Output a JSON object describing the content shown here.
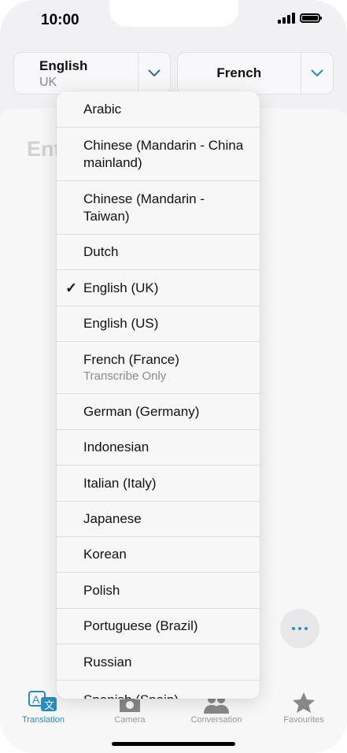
{
  "status_bar": {
    "time": "10:00"
  },
  "language_selector": {
    "source": {
      "name": "English",
      "region": "UK"
    },
    "target": {
      "name": "French"
    }
  },
  "input": {
    "placeholder_partial": "Ent"
  },
  "dropdown": {
    "items": [
      {
        "label": "Arabic",
        "sub": "",
        "selected": false
      },
      {
        "label": "Chinese (Mandarin - China mainland)",
        "sub": "",
        "selected": false
      },
      {
        "label": "Chinese (Mandarin - Taiwan)",
        "sub": "",
        "selected": false
      },
      {
        "label": "Dutch",
        "sub": "",
        "selected": false
      },
      {
        "label": "English (UK)",
        "sub": "",
        "selected": true
      },
      {
        "label": "English (US)",
        "sub": "",
        "selected": false
      },
      {
        "label": "French (France)",
        "sub": "Transcribe Only",
        "selected": false
      },
      {
        "label": "German (Germany)",
        "sub": "",
        "selected": false
      },
      {
        "label": "Indonesian",
        "sub": "",
        "selected": false
      },
      {
        "label": "Italian (Italy)",
        "sub": "",
        "selected": false
      },
      {
        "label": "Japanese",
        "sub": "",
        "selected": false
      },
      {
        "label": "Korean",
        "sub": "",
        "selected": false
      },
      {
        "label": "Polish",
        "sub": "",
        "selected": false
      },
      {
        "label": "Portuguese (Brazil)",
        "sub": "",
        "selected": false
      },
      {
        "label": "Russian",
        "sub": "",
        "selected": false
      },
      {
        "label": "Spanish (Spain)",
        "sub": "",
        "selected": false
      }
    ],
    "check_glyph": "✓"
  },
  "tabbar": {
    "tabs": [
      {
        "label": "Translation",
        "icon": "translate-icon",
        "active": true
      },
      {
        "label": "Camera",
        "icon": "camera-icon",
        "active": false
      },
      {
        "label": "Conversation",
        "icon": "people-icon",
        "active": false
      },
      {
        "label": "Favourites",
        "icon": "star-icon",
        "active": false
      }
    ]
  },
  "colors": {
    "accent": "#2a8bc0",
    "tab_inactive": "#999999",
    "placeholder": "#d2d2d2"
  }
}
